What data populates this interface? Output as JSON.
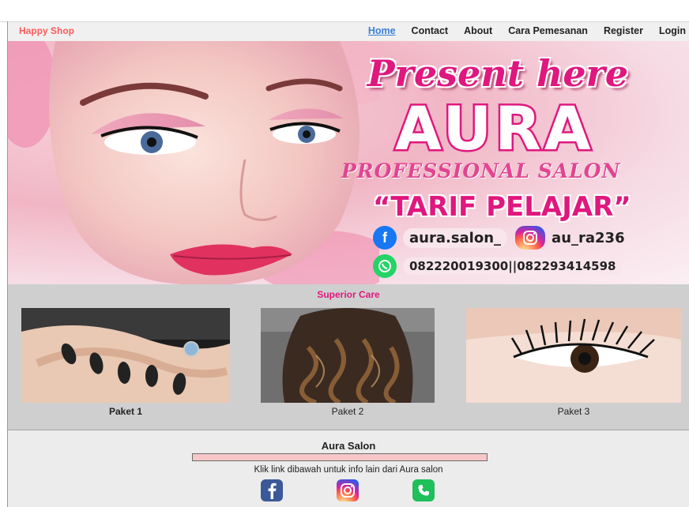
{
  "brand": "Happy Shop",
  "nav": [
    {
      "label": "Home",
      "active": true
    },
    {
      "label": "Contact"
    },
    {
      "label": "About"
    },
    {
      "label": "Cara Pemesanan"
    },
    {
      "label": "Register"
    },
    {
      "label": "Login"
    }
  ],
  "hero": {
    "line1": "Present here",
    "line2": "AURA",
    "line3": "PROFESSIONAL SALON",
    "line4": "“TARIF PELAJAR”",
    "facebook": "aura.salon_",
    "instagram": "au_ra236",
    "phones": "082220019300||082293414598",
    "icons": [
      "facebook-icon",
      "instagram-icon",
      "whatsapp-icon"
    ]
  },
  "care": {
    "title": "Superior Care",
    "packages": [
      {
        "label": "Paket 1"
      },
      {
        "label": "Paket 2"
      },
      {
        "label": "Paket 3"
      }
    ]
  },
  "footer": {
    "title": "Aura Salon",
    "text": "Klik link dibawah untuk info lain dari Aura salon",
    "icons": [
      "facebook-icon",
      "instagram-icon",
      "whatsapp-icon"
    ]
  },
  "colors": {
    "brand": "#ff5c5c",
    "accent": "#e0177e",
    "link_active": "#3b7fd8",
    "care_bg": "#cfcfcf",
    "footer_bar": "#f7c7c7"
  }
}
